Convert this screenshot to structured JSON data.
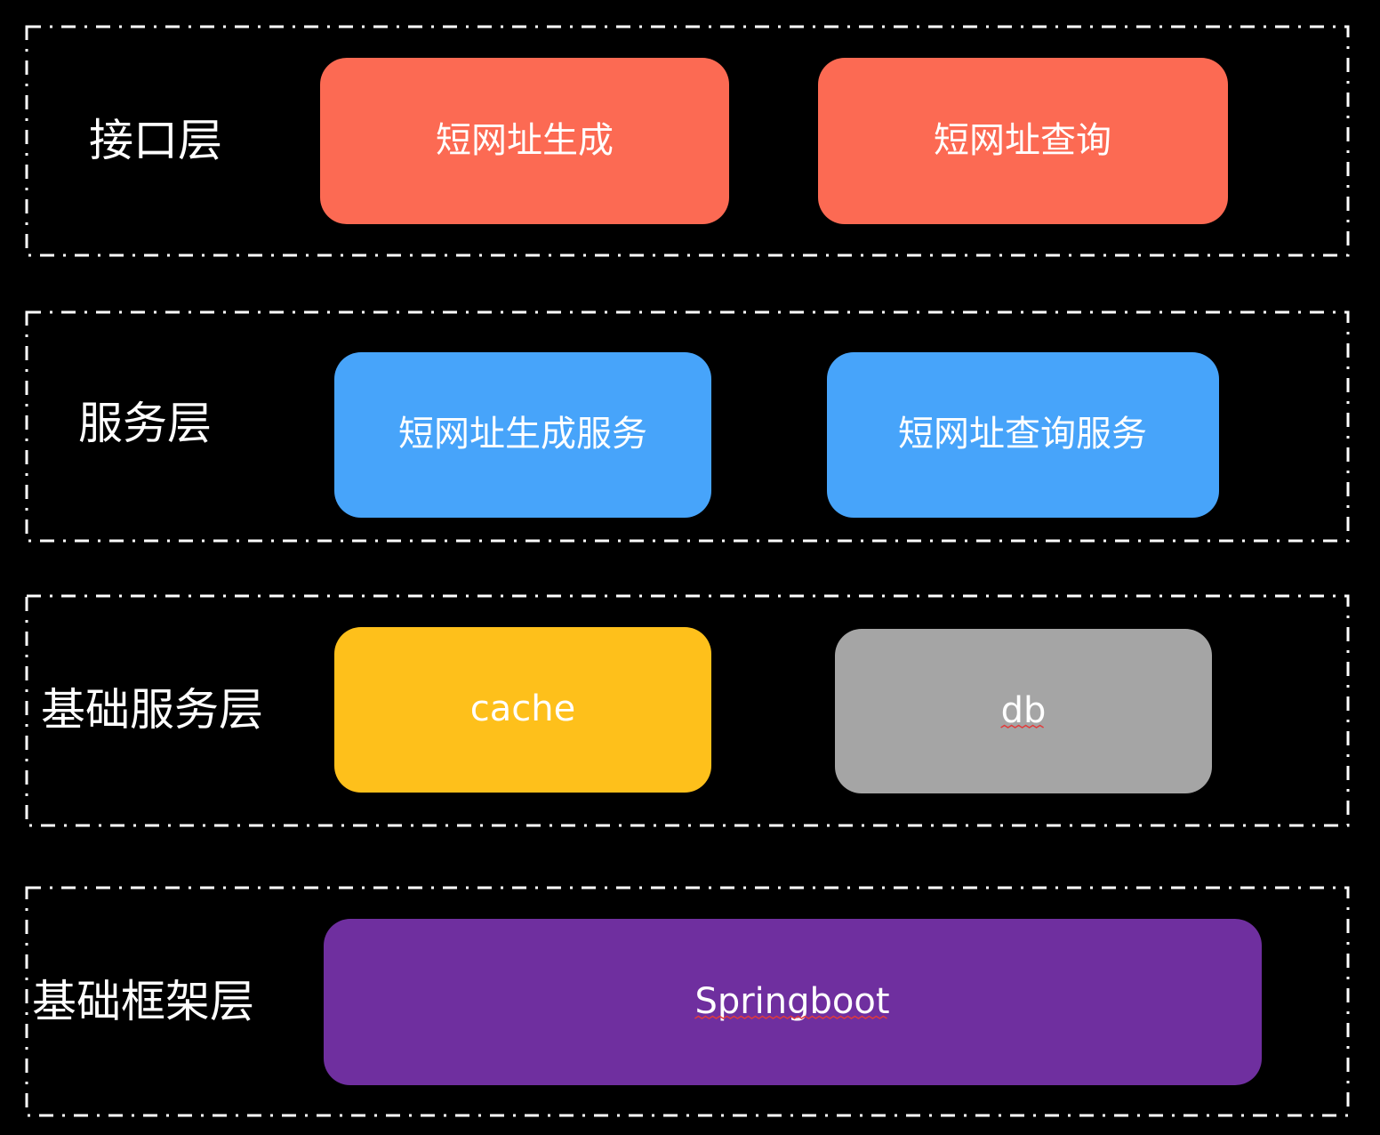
{
  "colors": {
    "background": "#000000",
    "frame": "#ffffff",
    "text": "#ffffff",
    "interface": "#fc6a53",
    "service": "#47a4fa",
    "cache": "#fec01b",
    "db": "#a5a5a5",
    "framework": "#6f2f9f",
    "spellcheck": "#e23b3b"
  },
  "layers": [
    {
      "label": "接口层",
      "boxes": [
        {
          "label": "短网址生成",
          "color": "interface"
        },
        {
          "label": "短网址查询",
          "color": "interface"
        }
      ]
    },
    {
      "label": "服务层",
      "boxes": [
        {
          "label": "短网址生成服务",
          "color": "service"
        },
        {
          "label": "短网址查询服务",
          "color": "service"
        }
      ]
    },
    {
      "label": "基础服务层",
      "boxes": [
        {
          "label": "cache",
          "color": "cache"
        },
        {
          "label": "db",
          "color": "db",
          "spellcheck": true
        }
      ]
    },
    {
      "label": "基础框架层",
      "boxes": [
        {
          "label": "Springboot",
          "color": "framework",
          "spellcheck": true
        }
      ]
    }
  ]
}
